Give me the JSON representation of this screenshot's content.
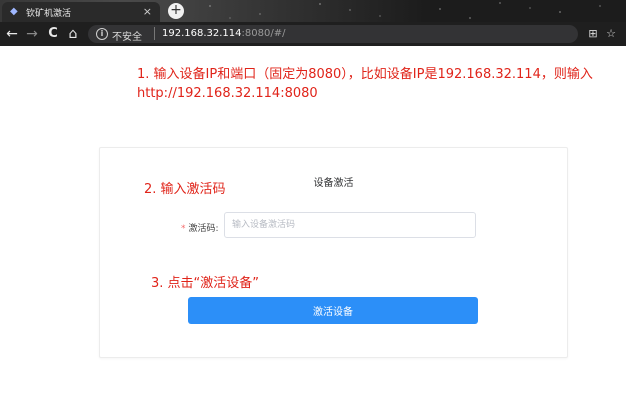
{
  "browser": {
    "tab_title": "钦矿机激活",
    "tab_close": "×",
    "new_tab": "+",
    "address": {
      "security_label": "不安全",
      "host": "192.168.32.114",
      "rest": ":8080/#/"
    },
    "nav": {
      "back": "←",
      "forward": "→",
      "reload": "C",
      "home": "⌂"
    },
    "right_icons": {
      "translate": "⊞",
      "bookmark": "☆"
    }
  },
  "instructions": {
    "step1_line1": "1. 输入设备IP和端口（固定为8080），比如设备IP是192.168.32.114，则输入",
    "step1_line2": "http://192.168.32.114:8080",
    "step2": "2. 输入激活码",
    "step3": "3. 点击“激活设备”"
  },
  "form": {
    "title": "设备激活",
    "required_mark": "*",
    "code_label": "激活码:",
    "code_placeholder": "输入设备激活码",
    "code_value": "",
    "submit_label": "激活设备"
  },
  "colors": {
    "annotation_red": "#e0241a",
    "primary_button": "#2c8ff8"
  }
}
